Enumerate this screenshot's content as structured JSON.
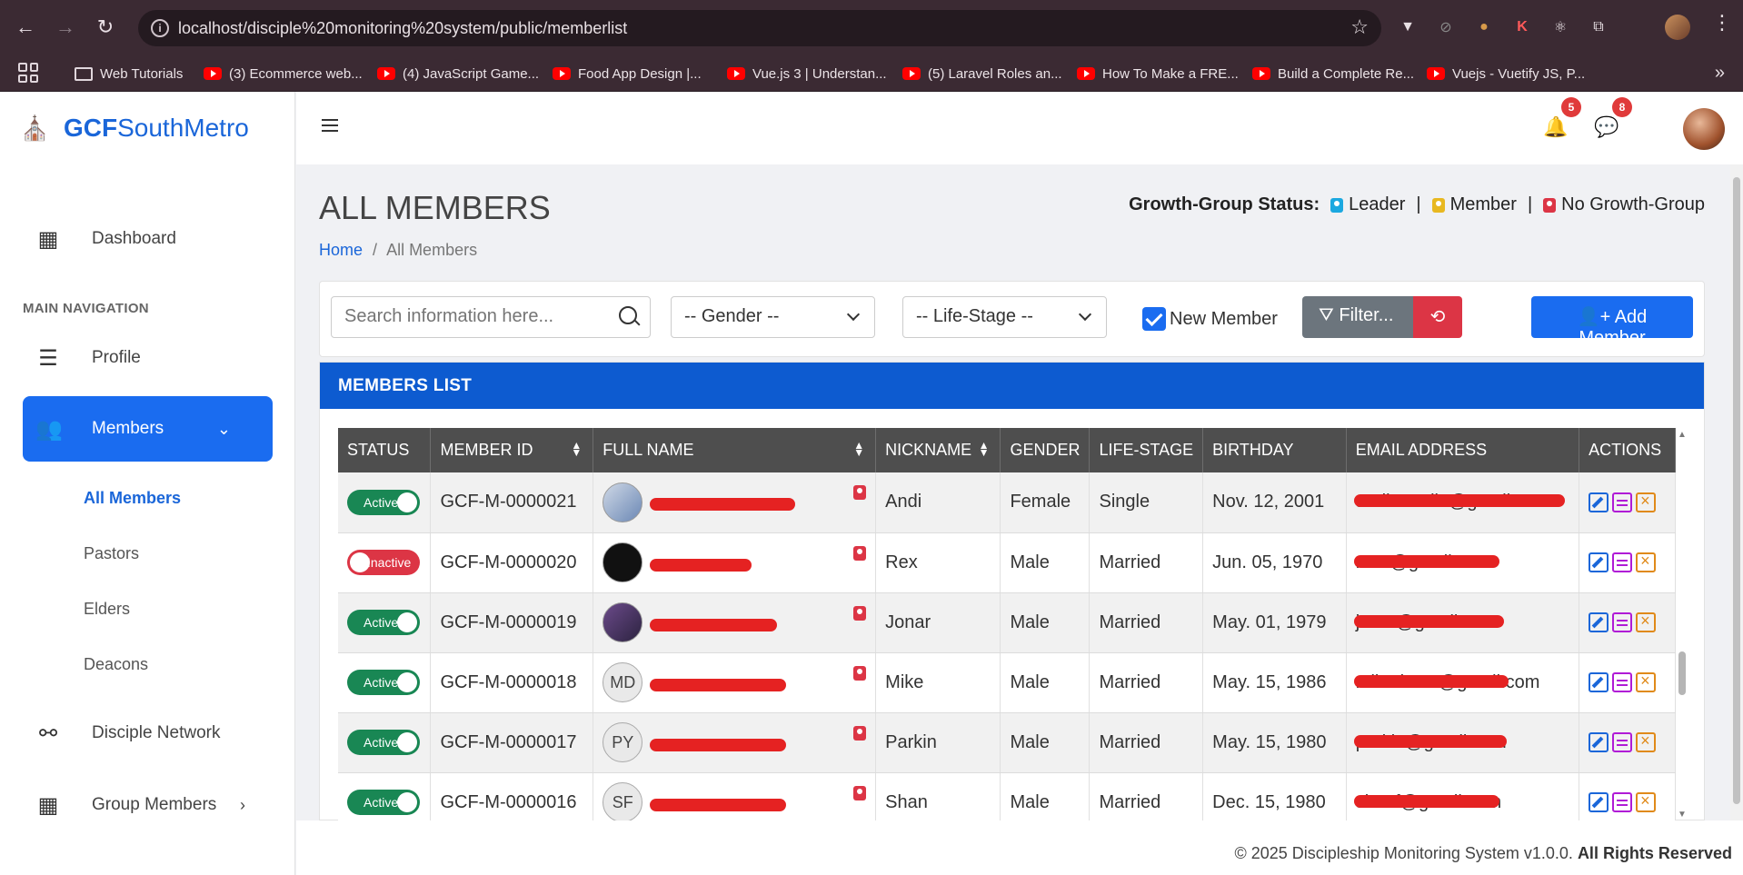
{
  "browser": {
    "url": "localhost/disciple%20monitoring%20system/public/memberlist",
    "bookmarks": [
      {
        "label": "Web Tutorials",
        "type": "folder"
      },
      {
        "label": "(3) Ecommerce web...",
        "type": "youtube"
      },
      {
        "label": "(4) JavaScript Game...",
        "type": "youtube"
      },
      {
        "label": "Food App Design |...",
        "type": "youtube"
      },
      {
        "label": "Vue.js 3 | Understan...",
        "type": "youtube"
      },
      {
        "label": "(5) Laravel Roles an...",
        "type": "youtube"
      },
      {
        "label": "How To Make a FRE...",
        "type": "youtube"
      },
      {
        "label": "Build a Complete Re...",
        "type": "youtube"
      },
      {
        "label": "Vuejs - Vuetify JS, P...",
        "type": "youtube"
      }
    ]
  },
  "brand": {
    "bold": "GCF",
    "rest": "SouthMetro"
  },
  "sidebar": {
    "dashboard": "Dashboard",
    "section": "MAIN NAVIGATION",
    "profile": "Profile",
    "members": "Members",
    "sub": [
      "All Members",
      "Pastors",
      "Elders",
      "Deacons"
    ],
    "network": "Disciple Network",
    "group": "Group Members"
  },
  "header": {
    "notif_count": "5",
    "msg_count": "8"
  },
  "page": {
    "title": "ALL MEMBERS",
    "crumb_home": "Home",
    "crumb_sep": "/",
    "crumb_current": "All Members",
    "gg_label": "Growth-Group Status:",
    "gg_leader": "Leader",
    "gg_member": "Member",
    "gg_none": "No Growth-Group",
    "gg_sep": "|",
    "colors": {
      "leader": "#1ba8e0",
      "member": "#e8b820",
      "none": "#dc3545"
    }
  },
  "filters": {
    "search_placeholder": "Search information here...",
    "gender": "-- Gender --",
    "lifestage": "-- Life-Stage --",
    "new_member": "New Member",
    "filter": "Filter...",
    "add": "Add Member"
  },
  "list": {
    "title": "MEMBERS LIST",
    "columns": [
      "STATUS",
      "MEMBER ID",
      "FULL NAME",
      "NICKNAME",
      "GENDER",
      "LIFE-STAGE",
      "BIRTHDAY",
      "EMAIL ADDRESS",
      "ACTIONS"
    ],
    "rows": [
      {
        "status": "Active",
        "id": "GCF-M-0000021",
        "initials": "",
        "nickname": "Andi",
        "gender": "Female",
        "life": "Single",
        "birthday": "Nov. 12, 2001",
        "email": "andiestrella@gmail.com"
      },
      {
        "status": "Inactive",
        "id": "GCF-M-0000020",
        "initials": "",
        "nickname": "Rex",
        "gender": "Male",
        "life": "Married",
        "birthday": "Jun. 05, 1970",
        "email": "rexv@gmail.com"
      },
      {
        "status": "Active",
        "id": "GCF-M-0000019",
        "initials": "",
        "nickname": "Jonar",
        "gender": "Male",
        "life": "Married",
        "birthday": "May. 01, 1979",
        "email": "jonar@gmail.com"
      },
      {
        "status": "Active",
        "id": "GCF-M-0000018",
        "initials": "MD",
        "nickname": "Mike",
        "gender": "Male",
        "life": "Married",
        "birthday": "May. 15, 1986",
        "email": "mikedcruz@gmail.com"
      },
      {
        "status": "Active",
        "id": "GCF-M-0000017",
        "initials": "PY",
        "nickname": "Parkin",
        "gender": "Male",
        "life": "Married",
        "birthday": "May. 15, 1980",
        "email": "parkin@gmail.com"
      },
      {
        "status": "Active",
        "id": "GCF-M-0000016",
        "initials": "SF",
        "nickname": "Shan",
        "gender": "Male",
        "life": "Married",
        "birthday": "Dec. 15, 1980",
        "email": "shanf@gmail.com"
      }
    ]
  },
  "footer": {
    "text": "© 2025 Discipleship Monitoring System v1.0.0.",
    "rights": "All Rights Reserved"
  }
}
